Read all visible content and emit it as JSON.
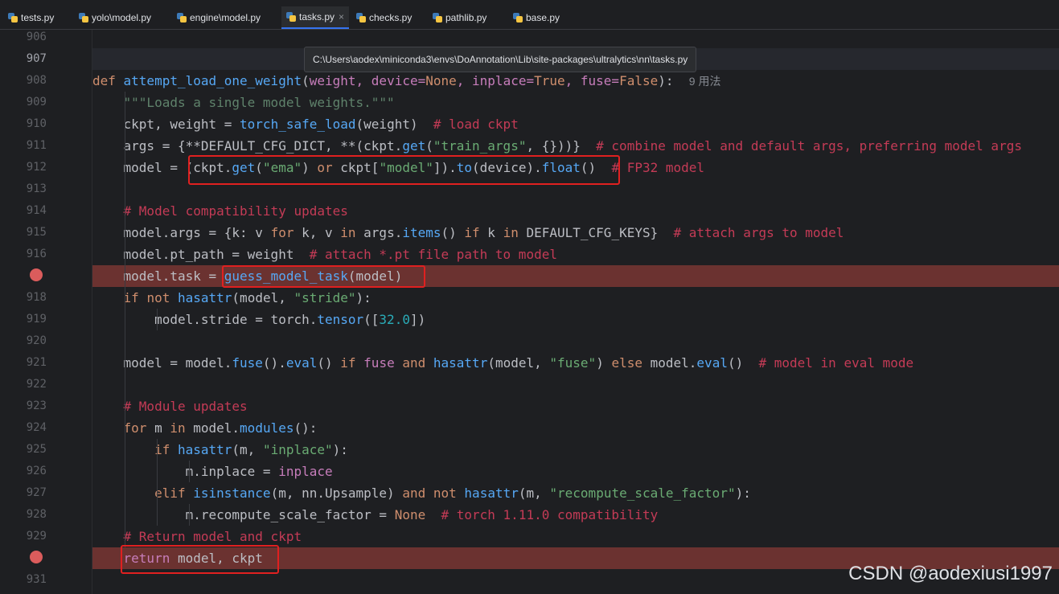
{
  "tabs": [
    {
      "label": "tests.py",
      "active": false
    },
    {
      "label": "yolo\\model.py",
      "active": false
    },
    {
      "label": "engine\\model.py",
      "active": false
    },
    {
      "label": "tasks.py",
      "active": true,
      "close": "×"
    },
    {
      "label": "checks.py",
      "active": false
    },
    {
      "label": "pathlib.py",
      "active": false
    },
    {
      "label": "base.py",
      "active": false
    }
  ],
  "tooltip": "C:\\Users\\aodex\\miniconda3\\envs\\DoAnnotation\\Lib\\site-packages\\ultralytics\\nn\\tasks.py",
  "line_numbers": [
    "906",
    "907",
    "908",
    "909",
    "910",
    "911",
    "912",
    "913",
    "914",
    "915",
    "916",
    "",
    "918",
    "919",
    "920",
    "921",
    "922",
    "923",
    "924",
    "925",
    "926",
    "927",
    "928",
    "929",
    "",
    "931"
  ],
  "breakpoint_lines": [
    917,
    930
  ],
  "code": {
    "l908": {
      "def": "def ",
      "name": "attempt_load_one_weight",
      "open": "(",
      "params": "weight, device=",
      "none": "None",
      ", ": ", inplace=",
      "true": "True",
      ", fuse=": ", fuse=",
      "false": "False",
      "close": "):",
      "hint": "9 用法"
    },
    "l909": "\"\"\"Loads a single model weights.\"\"\"",
    "l910": {
      "a": "ckpt, weight = ",
      "f": "torch_safe_load",
      "b": "(weight)",
      "c": "# load ckpt"
    },
    "l911": {
      "a": "args = {**DEFAULT_CFG_DICT, **(ckpt.",
      "f": "get",
      "b": "(",
      "s": "\"train_args\"",
      "d": ", {}))}",
      "c": "# combine model and default args, preferring model args"
    },
    "l912": {
      "a": "model = (ckpt.",
      "f1": "get",
      "b": "(",
      "s1": "\"ema\"",
      "c1": ") ",
      "or": "or",
      "d": " ckpt[",
      "s2": "\"model\"",
      "e": "]).",
      "f2": "to",
      "g": "(device).",
      "f3": "float",
      "h": "()",
      "c": "# FP32 model"
    },
    "l914": "# Model compatibility updates",
    "l915": {
      "a": "model.args = {k: v ",
      "for": "for",
      "b": " k, v ",
      "in": "in",
      "c": " args.",
      "f": "items",
      "d": "() ",
      "if": "if",
      "e": " k ",
      "in2": "in",
      "g": " DEFAULT_CFG_KEYS}",
      "cm": "# attach args to model"
    },
    "l916": {
      "a": "model.pt_path = weight",
      "c": "# attach *.pt file path to model"
    },
    "l917": {
      "a": "model.task = ",
      "f": "guess_model_task",
      "b": "(model)"
    },
    "l918": {
      "if": "if",
      "not": "not",
      "f": "hasattr",
      "a": "(model, ",
      "s": "\"stride\"",
      "b": "):"
    },
    "l919": {
      "a": "model.stride = torch.",
      "f": "tensor",
      "b": "([",
      "n": "32.0",
      "c": "])"
    },
    "l921": {
      "a": "model = model.",
      "f1": "fuse",
      "b": "().",
      "f2": "eval",
      "c": "() ",
      "if": "if",
      "d": " ",
      "fuse": "fuse",
      "and": "and",
      "f3": "hasattr",
      "e": "(model, ",
      "s": "\"fuse\"",
      "g": ") ",
      "else": "else",
      "h": " model.",
      "f4": "eval",
      "i": "()",
      "cm": "# model in eval mode"
    },
    "l923": "# Module updates",
    "l924": {
      "for": "for",
      "a": " m ",
      "in": "in",
      "b": " model.",
      "f": "modules",
      "c": "():"
    },
    "l925": {
      "if": "if",
      "f": "hasattr",
      "a": "(m, ",
      "s": "\"inplace\"",
      "b": "):"
    },
    "l926": {
      "a": "m.inplace = ",
      "v": "inplace"
    },
    "l927": {
      "elif": "elif",
      "f1": "isinstance",
      "a": "(m, nn.Upsample) ",
      "and": "and",
      "not": "not",
      "f2": "hasattr",
      "b": "(m, ",
      "s": "\"recompute_scale_factor\"",
      "c": "):"
    },
    "l928": {
      "a": "m.recompute_scale_factor = ",
      "none": "None",
      "cm": "# torch 1.11.0 compatibility"
    },
    "l929": "# Return model and ckpt",
    "l930": {
      "ret": "return",
      "a": " model, ckpt"
    }
  },
  "watermark": "CSDN @aodexiusi1997",
  "colors": {
    "keyword": "#cf8e6d",
    "function": "#56a8f5",
    "string": "#6aab73",
    "comment": "#c43b56",
    "breakpoint": "#db5c5c",
    "highlight_box": "#e02020"
  }
}
